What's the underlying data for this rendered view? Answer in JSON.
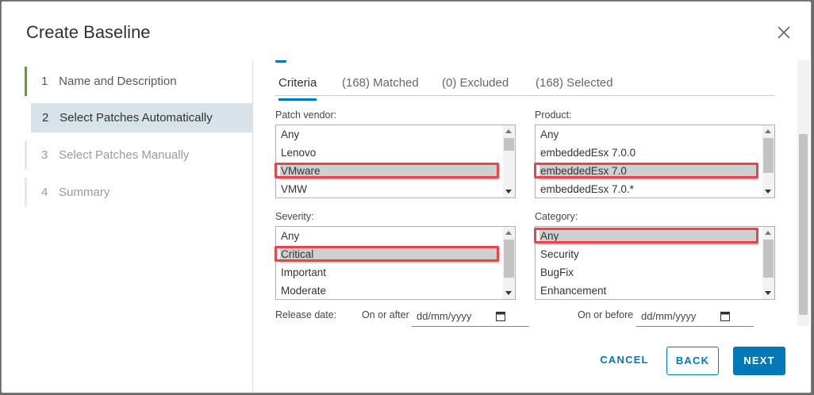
{
  "dialog": {
    "title": "Create Baseline",
    "close_icon": "close-icon"
  },
  "steps": [
    {
      "num": "1",
      "label": "Name and Description",
      "state": "done"
    },
    {
      "num": "2",
      "label": "Select Patches Automatically",
      "state": "active"
    },
    {
      "num": "3",
      "label": "Select Patches Manually",
      "state": "disabled"
    },
    {
      "num": "4",
      "label": "Summary",
      "state": "disabled"
    }
  ],
  "tabs": [
    {
      "label": "Criteria",
      "active": true
    },
    {
      "label": "(168) Matched",
      "active": false
    },
    {
      "label": "(0) Excluded",
      "active": false
    },
    {
      "label": "(168) Selected",
      "active": false
    }
  ],
  "patch_vendor": {
    "label": "Patch vendor:",
    "options": [
      "Any",
      "Lenovo",
      "VMware",
      "VMW"
    ],
    "selected": "VMware"
  },
  "product": {
    "label": "Product:",
    "options": [
      "Any",
      "embeddedEsx 7.0.0",
      "embeddedEsx 7.0",
      "embeddedEsx 7.0.*"
    ],
    "selected": "embeddedEsx 7.0"
  },
  "severity": {
    "label": "Severity:",
    "options": [
      "Any",
      "Critical",
      "Important",
      "Moderate"
    ],
    "selected": "Critical"
  },
  "category": {
    "label": "Category:",
    "options": [
      "Any",
      "Security",
      "BugFix",
      "Enhancement"
    ],
    "selected": "Any"
  },
  "release_date": {
    "label": "Release date:",
    "on_or_after_label": "On or after",
    "on_or_after_placeholder": "dd/mm/yyyy",
    "on_or_before_label": "On or before",
    "on_or_before_placeholder": "dd/mm/yyyy",
    "calendar_icon": "calendar-icon"
  },
  "footer": {
    "cancel_label": "CANCEL",
    "back_label": "BACK",
    "next_label": "NEXT"
  },
  "colors": {
    "accent": "#0079b8",
    "step_done": "#5aa220",
    "highlight_annotation": "#e8444a",
    "active_step_bg": "#d8e3e9"
  }
}
